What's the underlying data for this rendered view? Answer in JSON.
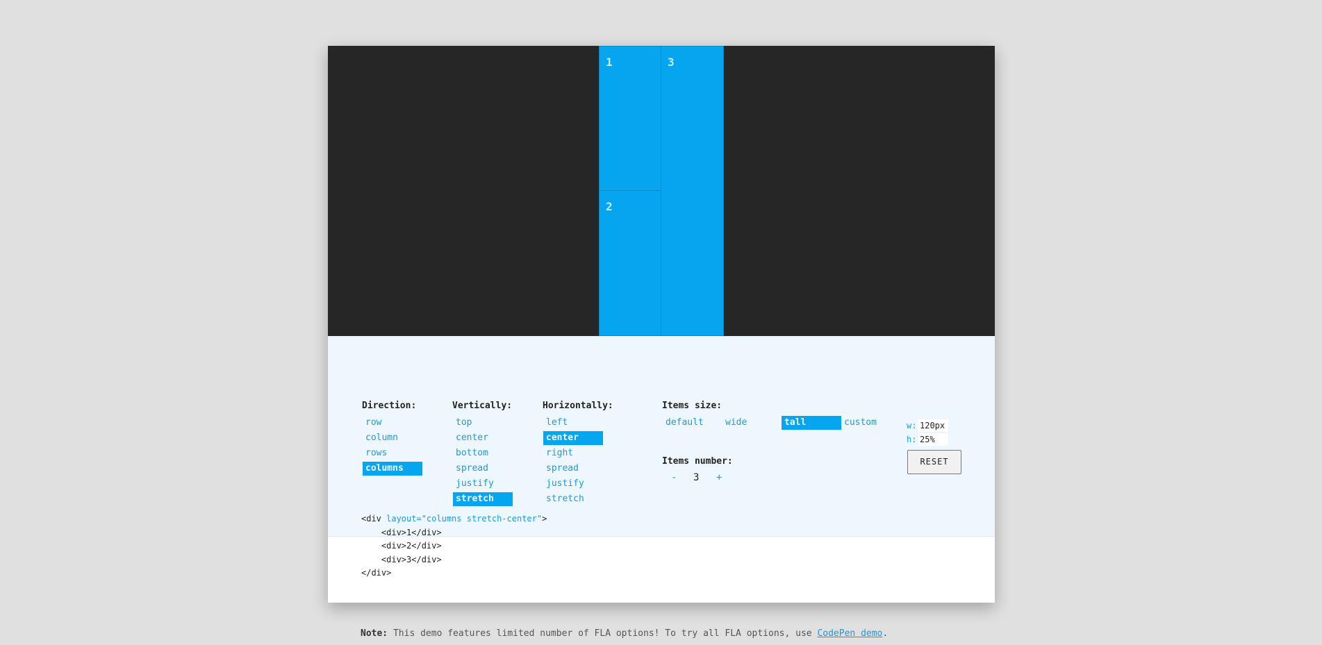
{
  "preview": {
    "items": [
      {
        "label": "1"
      },
      {
        "label": "2"
      },
      {
        "label": "3"
      }
    ]
  },
  "controls": {
    "direction": {
      "heading": "Direction:",
      "options": [
        "row",
        "column",
        "rows",
        "columns"
      ],
      "selected": "columns"
    },
    "vertically": {
      "heading": "Vertically:",
      "options": [
        "top",
        "center",
        "bottom",
        "spread",
        "justify",
        "stretch"
      ],
      "selected": "stretch"
    },
    "horizontally": {
      "heading": "Horizontally:",
      "options": [
        "left",
        "center",
        "right",
        "spread",
        "justify",
        "stretch"
      ],
      "selected": "center"
    },
    "items_size": {
      "heading": "Items size:",
      "options": [
        "default",
        "wide",
        "tall",
        "custom"
      ],
      "selected": "tall",
      "w_label": "w:",
      "w_value": "120px",
      "h_label": "h:",
      "h_value": "25%"
    },
    "items_number": {
      "heading": "Items number:",
      "minus": "-",
      "value": "3",
      "plus": "+"
    },
    "reset_label": "RESET"
  },
  "code": {
    "open_tag_start": "<div ",
    "attr": "layout=\"columns stretch-center\"",
    "open_tag_end": ">",
    "lines": [
      "    <div>1</div>",
      "    <div>2</div>",
      "    <div>3</div>"
    ],
    "close_tag": "</div>"
  },
  "note": {
    "label": "Note:",
    "text": " This demo features limited number of FLA options! To try all FLA options, use ",
    "link": "CodePen demo",
    "end": "."
  },
  "colors": {
    "accent": "#05a5f0",
    "preview_bg": "#262626",
    "controls_bg": "#eef7fd",
    "page_bg": "#e0e0e0"
  }
}
